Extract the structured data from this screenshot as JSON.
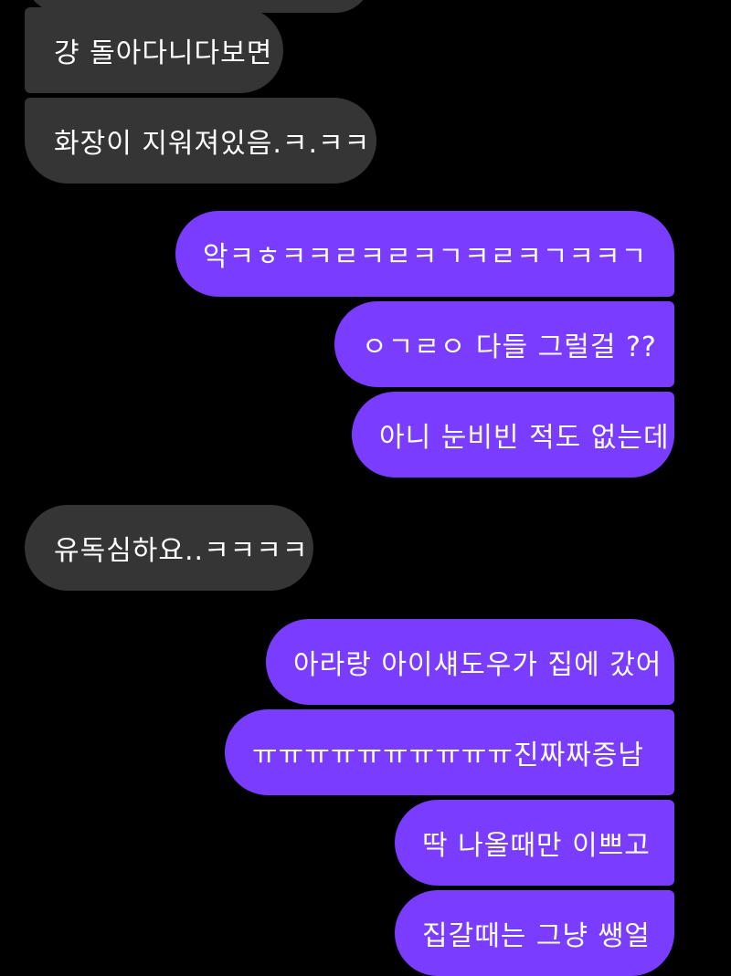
{
  "colors": {
    "background": "#000000",
    "received_bubble": "#353535",
    "sent_bubble": "#7a3cff",
    "text": "#ffffff"
  },
  "messages": [
    {
      "side": "received",
      "text": ""
    },
    {
      "side": "received",
      "text": "걍 돌아다니다보면"
    },
    {
      "side": "received",
      "text": "화장이 지워져있음.ㅋ.ㅋㅋ"
    },
    {
      "side": "sent",
      "text": "악ㅋㅎㅋㅋㄹㅋㄹㅋㄱㅋㄹㅋㄱㅋㅋㄱ"
    },
    {
      "side": "sent",
      "text": "ㅇㄱㄹㅇ 다들 그럴걸 ??"
    },
    {
      "side": "sent",
      "text": "아니 눈비빈 적도 없는데"
    },
    {
      "side": "received",
      "text": "유독심하요..ㅋㅋㅋㅋ"
    },
    {
      "side": "sent",
      "text": "아라랑 아이섀도우가 집에 갔어"
    },
    {
      "side": "sent",
      "text": "ㅠㅠㅠㅠㅠㅠㅠㅠㅠㅠ진짜짜증남"
    },
    {
      "side": "sent",
      "text": "딱 나올때만 이쁘고"
    },
    {
      "side": "sent",
      "text": "집갈때는 그냥 쌩얼"
    }
  ]
}
